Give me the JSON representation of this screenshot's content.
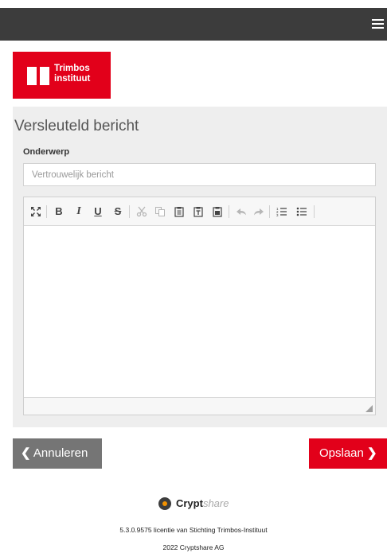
{
  "header": {
    "menu_icon": "hamburger-menu-icon"
  },
  "logo": {
    "line1": "Trimbos",
    "line2": "instituut",
    "brand_color": "#e2001a"
  },
  "panel": {
    "title": "Versleuteld bericht"
  },
  "subject": {
    "label": "Onderwerp",
    "placeholder": "Vertrouwelijk bericht",
    "value": ""
  },
  "editor": {
    "toolbar": [
      {
        "icon": "maximize-icon",
        "enabled": true
      },
      {
        "icon": "bold-icon",
        "label": "B",
        "enabled": true
      },
      {
        "icon": "italic-icon",
        "label": "I",
        "enabled": true
      },
      {
        "icon": "underline-icon",
        "label": "U",
        "enabled": true
      },
      {
        "icon": "strikethrough-icon",
        "label": "S",
        "enabled": true
      },
      {
        "icon": "cut-icon",
        "enabled": false
      },
      {
        "icon": "copy-icon",
        "enabled": false
      },
      {
        "icon": "paste-icon",
        "enabled": true
      },
      {
        "icon": "paste-text-icon",
        "enabled": true
      },
      {
        "icon": "paste-word-icon",
        "enabled": true
      },
      {
        "icon": "undo-icon",
        "enabled": false
      },
      {
        "icon": "redo-icon",
        "enabled": false
      },
      {
        "icon": "numbered-list-icon",
        "enabled": true
      },
      {
        "icon": "bulleted-list-icon",
        "enabled": true
      }
    ],
    "content": ""
  },
  "actions": {
    "cancel_label": "Annuleren",
    "save_label": "Opslaan",
    "cancel_color": "#757575",
    "save_color": "#e2001a"
  },
  "footer": {
    "brand_bold": "Crypt",
    "brand_light": "share",
    "version_line": "5.3.0.9575 licentie van Stichting Trimbos-Instituut",
    "copyright": "2022 Cryptshare AG"
  }
}
